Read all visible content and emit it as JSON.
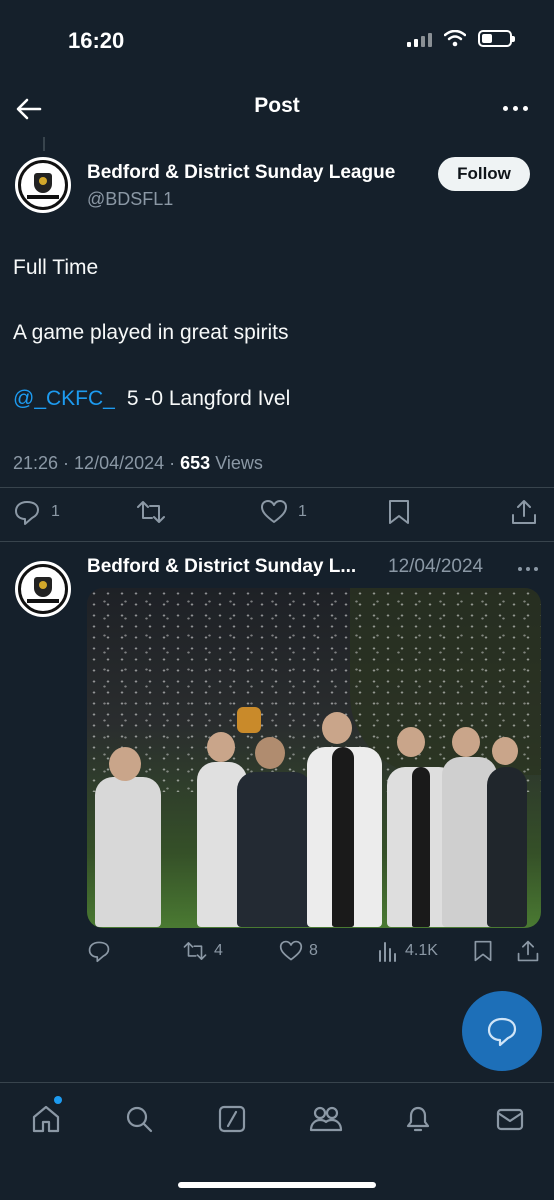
{
  "status_bar": {
    "time": "16:20"
  },
  "header": {
    "title": "Post"
  },
  "author": {
    "name": "Bedford & District Sunday League",
    "handle": "@BDSFL1",
    "follow_label": "Follow"
  },
  "post": {
    "line1": "Full Time",
    "line2": "A game played in great spirits",
    "mention": "@_CKFC_",
    "score_text": "5 -0 Langford Ivel",
    "time": "21:26",
    "date": "12/04/2024",
    "views_count": "653",
    "views_label": "Views",
    "reply_count": "1",
    "like_count": "1"
  },
  "reply": {
    "name": "Bedford & District Sunday L...",
    "date": "12/04/2024",
    "retweet_count": "4",
    "like_count": "8",
    "views": "4.1K"
  },
  "colors": {
    "accent": "#1d9bf0",
    "background": "#15202b",
    "muted": "#8b98a5"
  },
  "icons": [
    "back-arrow-icon",
    "more-icon",
    "reply-icon",
    "retweet-icon",
    "like-icon",
    "bookmark-icon",
    "share-icon",
    "views-icon",
    "compose-icon",
    "home-icon",
    "search-icon",
    "grok-icon",
    "communities-icon",
    "notifications-icon",
    "messages-icon"
  ]
}
